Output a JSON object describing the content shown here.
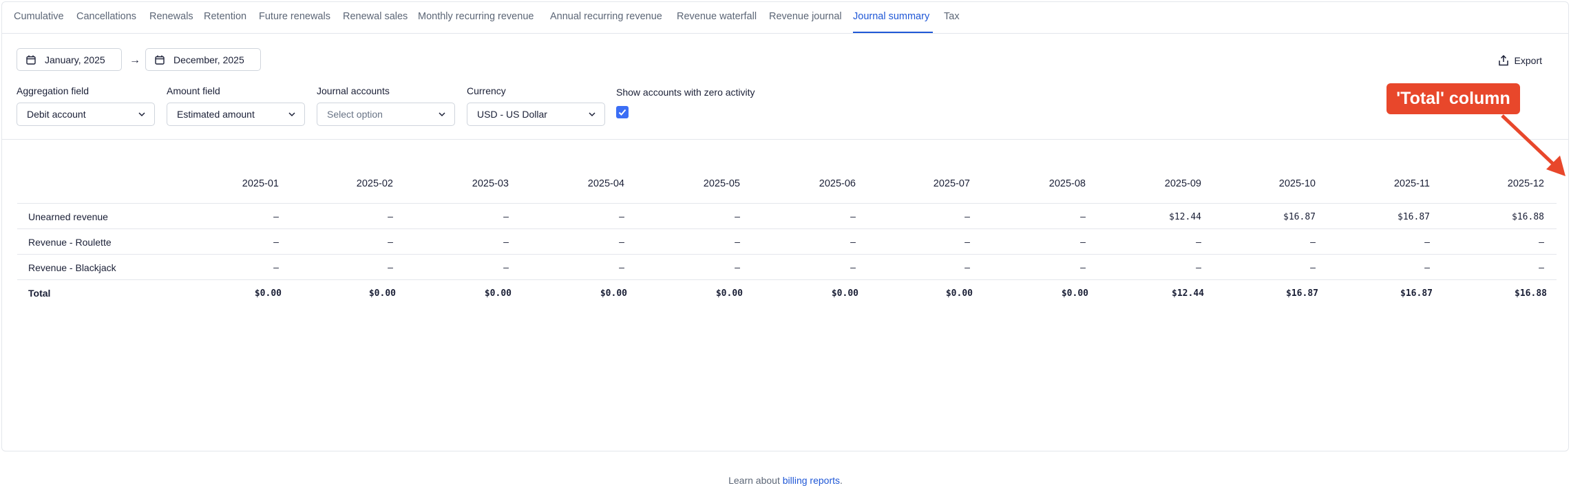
{
  "tabs": [
    "Cumulative",
    "Cancellations",
    "Renewals",
    "Retention",
    "Future renewals",
    "Renewal sales",
    "Monthly recurring revenue",
    "Annual recurring revenue",
    "Revenue waterfall",
    "Revenue journal",
    "Journal summary",
    "Tax"
  ],
  "active_tab": "Journal summary",
  "date_range": {
    "start": "January, 2025",
    "arrow": "→",
    "end": "December, 2025"
  },
  "export_label": "Export",
  "filters": {
    "aggregation": {
      "label": "Aggregation field",
      "value": "Debit account"
    },
    "amount": {
      "label": "Amount field",
      "value": "Estimated amount"
    },
    "journal_accounts": {
      "label": "Journal accounts",
      "placeholder": "Select option"
    },
    "currency": {
      "label": "Currency",
      "value": "USD - US Dollar"
    },
    "zero_activity": {
      "label": "Show accounts with zero activity",
      "checked": true
    }
  },
  "table": {
    "columns": [
      "2025-01",
      "2025-02",
      "2025-03",
      "2025-04",
      "2025-05",
      "2025-06",
      "2025-07",
      "2025-08",
      "2025-09",
      "2025-10",
      "2025-11",
      "2025-12"
    ],
    "rows": [
      {
        "label": "Unearned revenue",
        "values": [
          "–",
          "–",
          "–",
          "–",
          "–",
          "–",
          "–",
          "–",
          "$12.44",
          "$16.87",
          "$16.87",
          "$16.88"
        ]
      },
      {
        "label": "Revenue - Roulette",
        "values": [
          "–",
          "–",
          "–",
          "–",
          "–",
          "–",
          "–",
          "–",
          "–",
          "–",
          "–",
          "–"
        ]
      },
      {
        "label": "Revenue - Blackjack",
        "values": [
          "–",
          "–",
          "–",
          "–",
          "–",
          "–",
          "–",
          "–",
          "–",
          "–",
          "–",
          "–"
        ]
      }
    ],
    "total": {
      "label": "Total",
      "values": [
        "$0.00",
        "$0.00",
        "$0.00",
        "$0.00",
        "$0.00",
        "$0.00",
        "$0.00",
        "$0.00",
        "$12.44",
        "$16.87",
        "$16.87",
        "$16.88"
      ]
    }
  },
  "annotation": {
    "text": "'Total' column",
    "color": "#e8472b"
  },
  "footer": {
    "prefix": "Learn about ",
    "link": "billing reports",
    "suffix": "."
  },
  "colors": {
    "accent": "#1f57d6",
    "checkbox": "#3b6ef5"
  }
}
